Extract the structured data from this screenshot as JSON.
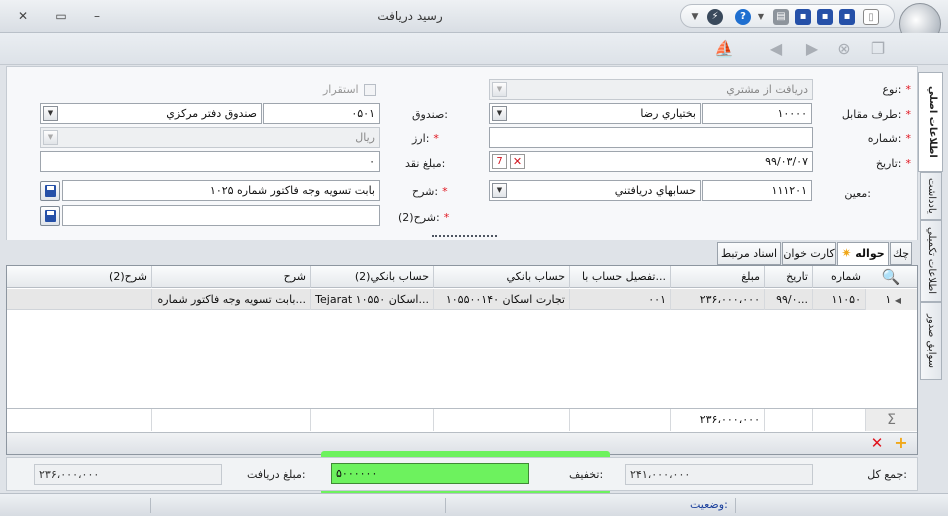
{
  "window": {
    "title": "رسيد دريافت"
  },
  "form": {
    "type": {
      "label": "نوع:",
      "value": "دریافت از مشتري"
    },
    "stability": {
      "label": "استقرار"
    },
    "counterparty": {
      "label": "طرف مقابل:",
      "code": "۱۰۰۰۰",
      "name": "بختياري رضا"
    },
    "box": {
      "label": "صندوق:",
      "code": "۰۵۰۱",
      "name": "صندوق دفتر مركزي"
    },
    "number": {
      "label": "شماره:",
      "value": ""
    },
    "currency": {
      "label": "ارز:",
      "value": "ريال"
    },
    "date": {
      "label": "تاريخ:",
      "value": "۹۹/۰۳/۰۷"
    },
    "cash_amount": {
      "label": "مبلغ نقد:",
      "value": "۰"
    },
    "account": {
      "label": "معين:",
      "code": "۱۱۱۲۰۱",
      "name": "حسابهاي دريافتني"
    },
    "description": {
      "label": "شرح:",
      "value": "بابت تسويه وجه فاكتور شماره ۱۰۲۵"
    },
    "description2": {
      "label": "شرح(2):",
      "value": ""
    }
  },
  "side_tabs": [
    "اطلاعات اصلي",
    "يادداشت",
    "اطلاعات تكميلي",
    "سوابق صدور"
  ],
  "tabs": [
    {
      "label": "چك"
    },
    {
      "label": "حواله"
    },
    {
      "label": "كارت خوان"
    },
    {
      "label": "اسناد مرتبط"
    }
  ],
  "grid": {
    "headers": [
      "شماره",
      "تاريخ",
      "مبلغ",
      "تفصيل حساب با...",
      "حساب بانكي",
      "حساب بانكي(2)",
      "شرح",
      "شرح(2)"
    ],
    "rows": [
      {
        "index": "۱",
        "number": "۱۱۰۵۰",
        "date": "۹۹/۰...",
        "amount": "۲۳۶،۰۰۰،۰۰۰",
        "detail": "۰۰۱",
        "bank": "تجارت اسكان ۱۰۵۵۰۰۱۴۰",
        "bank2": "Tejarat اسكان ۱۰۵۵۰...",
        "desc": "بابت تسويه وجه فاكتور شماره...",
        "desc2": ""
      }
    ],
    "footer_sum": "۲۳۶،۰۰۰،۰۰۰"
  },
  "totals": {
    "total_label": "جمع كل:",
    "total_value": "۲۴۱،۰۰۰،۰۰۰",
    "discount_label": "تخفيف:",
    "discount_value": "۵۰۰۰۰۰۰",
    "received_label": "مبلغ دريافت:",
    "received_value": "۲۳۶،۰۰۰،۰۰۰"
  },
  "status": {
    "label": "وضعيت:"
  }
}
